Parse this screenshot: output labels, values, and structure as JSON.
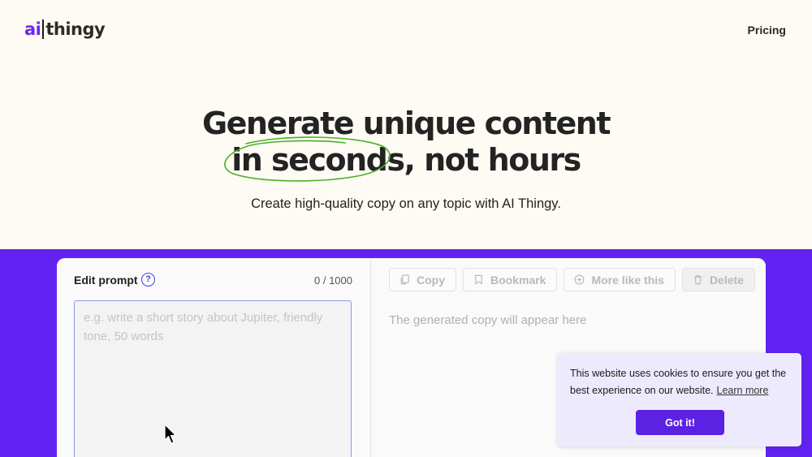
{
  "nav": {
    "logo_ai": "ai",
    "logo_thingy": "thingy",
    "pricing": "Pricing"
  },
  "hero": {
    "headline_line1": "Generate unique content",
    "headline_highlight": "in seconds",
    "headline_line2_rest": ", not hours",
    "subtitle": "Create high-quality copy on any topic with AI Thingy."
  },
  "editor": {
    "label": "Edit prompt",
    "help": "?",
    "counter": "0 / 1000",
    "value": "",
    "placeholder": "e.g. write a short story about Jupiter, friendly tone, 50 words"
  },
  "output": {
    "buttons": {
      "copy": "Copy",
      "bookmark": "Bookmark",
      "more": "More like this",
      "delete": "Delete"
    },
    "placeholder": "The generated copy will appear here"
  },
  "cookie": {
    "message": "This website uses cookies to ensure you get the best experience on our website.",
    "learn_more": "Learn more",
    "accept": "Got it!"
  },
  "colors": {
    "brand": "#6223f2",
    "page_bg": "#fdfbf3",
    "highlight_circle": "#4caf26",
    "cookie_bg": "#eeeafd",
    "cookie_button": "#5b22e4"
  }
}
